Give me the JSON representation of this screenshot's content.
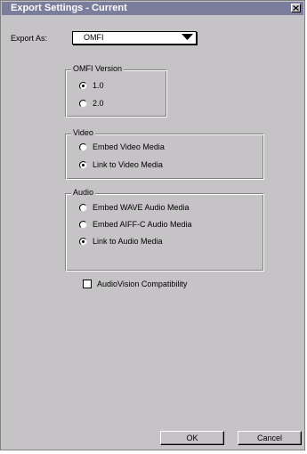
{
  "window": {
    "title": "Export Settings - Current",
    "close_glyph": "x-icon"
  },
  "export_as": {
    "label": "Export As:",
    "selected": "OMFI"
  },
  "omfi_version": {
    "title": "OMFI Version",
    "options": [
      {
        "label": "1.0",
        "checked": true
      },
      {
        "label": "2.0",
        "checked": false
      }
    ]
  },
  "video": {
    "title": "Video",
    "options": [
      {
        "label": "Embed Video Media",
        "checked": false
      },
      {
        "label": "Link to Video Media",
        "checked": true
      }
    ]
  },
  "audio": {
    "title": "Audio",
    "options": [
      {
        "label": "Embed WAVE Audio Media",
        "checked": false
      },
      {
        "label": "Embed AIFF-C Audio Media",
        "checked": false
      },
      {
        "label": "Link to Audio Media",
        "checked": true
      }
    ]
  },
  "audiovision": {
    "label": "AudioVision Compatibility",
    "checked": false
  },
  "buttons": {
    "ok": "OK",
    "cancel": "Cancel"
  }
}
